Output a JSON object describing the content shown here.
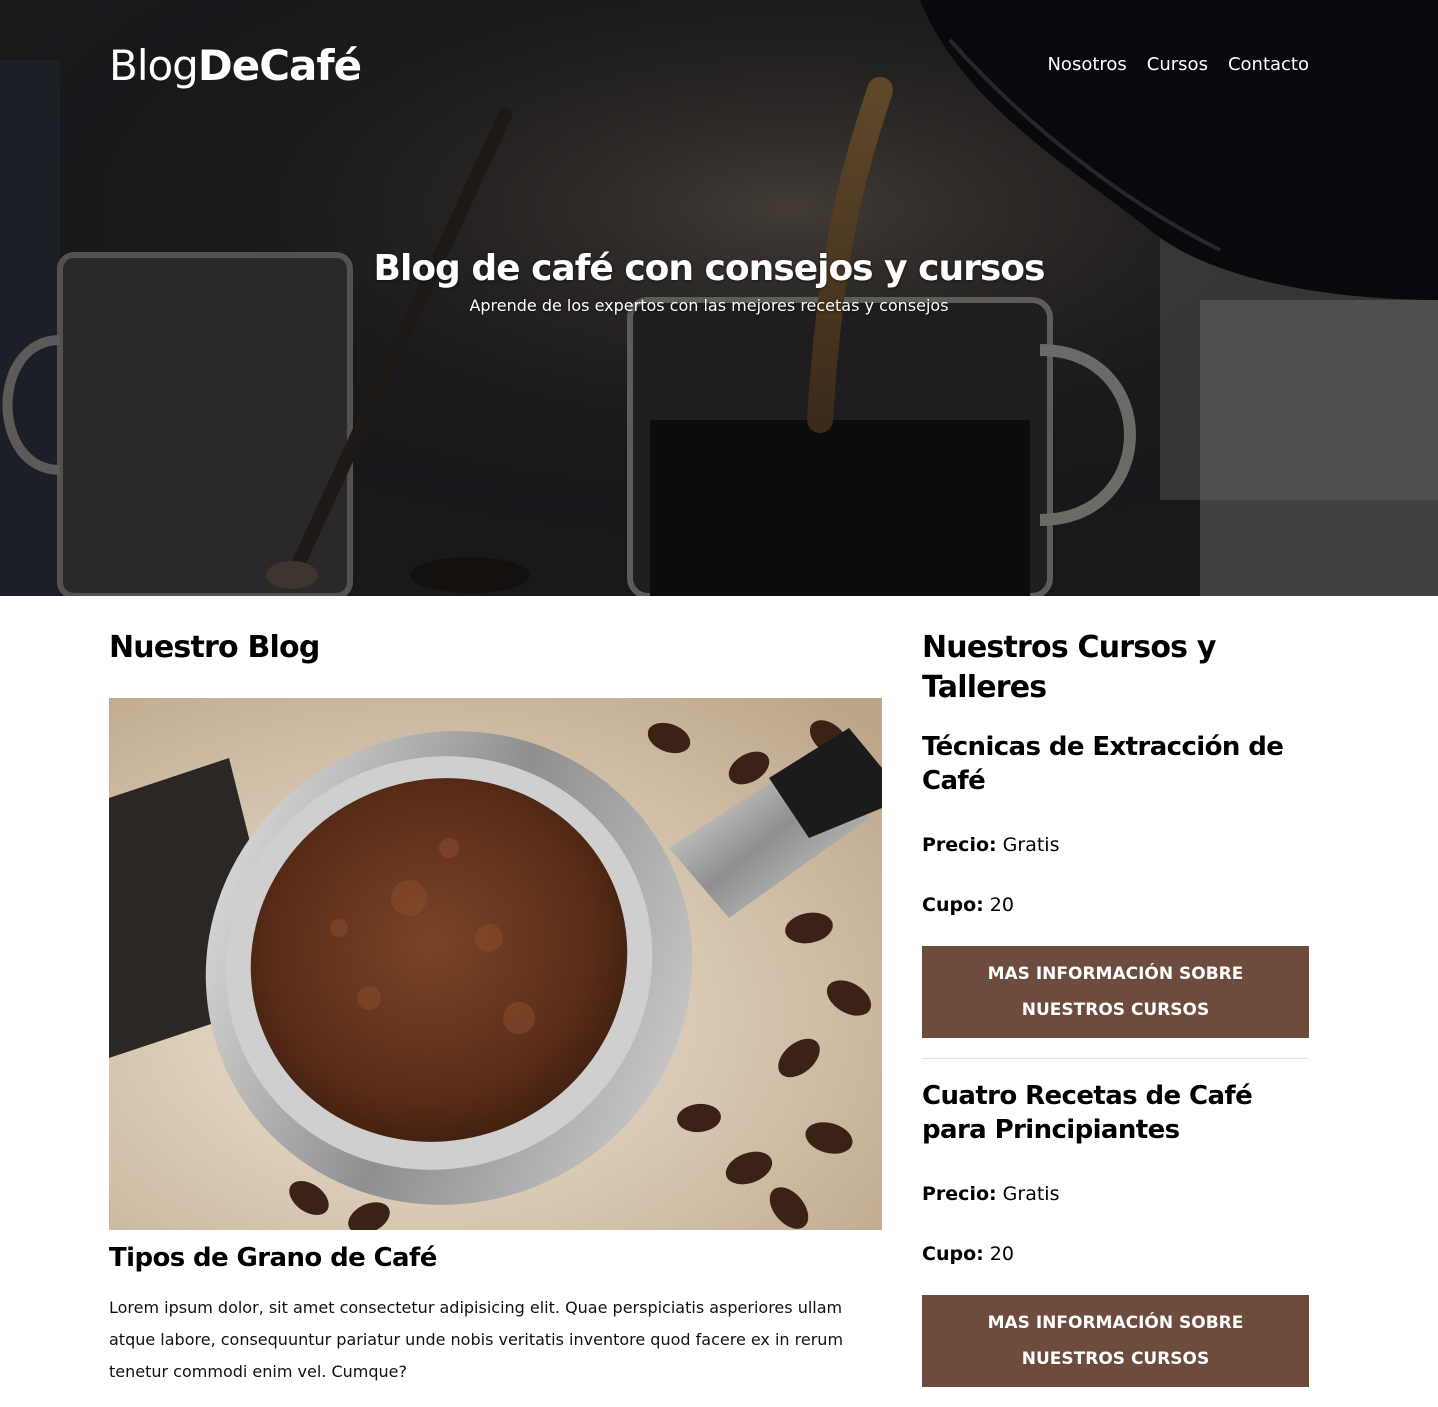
{
  "header": {
    "logo_light": "Blog",
    "logo_bold": "DeCafé",
    "nav": [
      {
        "label": "Nosotros"
      },
      {
        "label": "Cursos"
      },
      {
        "label": "Contacto"
      }
    ]
  },
  "hero": {
    "title": "Blog de café con consejos y cursos",
    "subtitle": "Aprende de los expertos con las mejores recetas y consejos"
  },
  "blog": {
    "section_title": "Nuestro Blog",
    "posts": [
      {
        "title": "Tipos de Grano de Café",
        "text": "Lorem ipsum dolor, sit amet consectetur adipisicing elit. Quae perspiciatis asperiores ullam atque labore, consequuntur pariatur unde nobis veritatis inventore quod facere ex in rerum tenetur commodi enim vel. Cumque?"
      }
    ]
  },
  "courses": {
    "section_title": "Nuestros Cursos y Talleres",
    "price_label": "Precio:",
    "quota_label": "Cupo:",
    "button_label": "MAS INFORMACIÓN SOBRE NUESTROS CURSOS",
    "items": [
      {
        "title": "Técnicas de Extracción de Café",
        "price": "Gratis",
        "quota": "20"
      },
      {
        "title": "Cuatro Recetas de Café para Principiantes",
        "price": "Gratis",
        "quota": "20"
      }
    ]
  },
  "colors": {
    "button_bg": "#6d4c3d",
    "text": "#000000"
  }
}
